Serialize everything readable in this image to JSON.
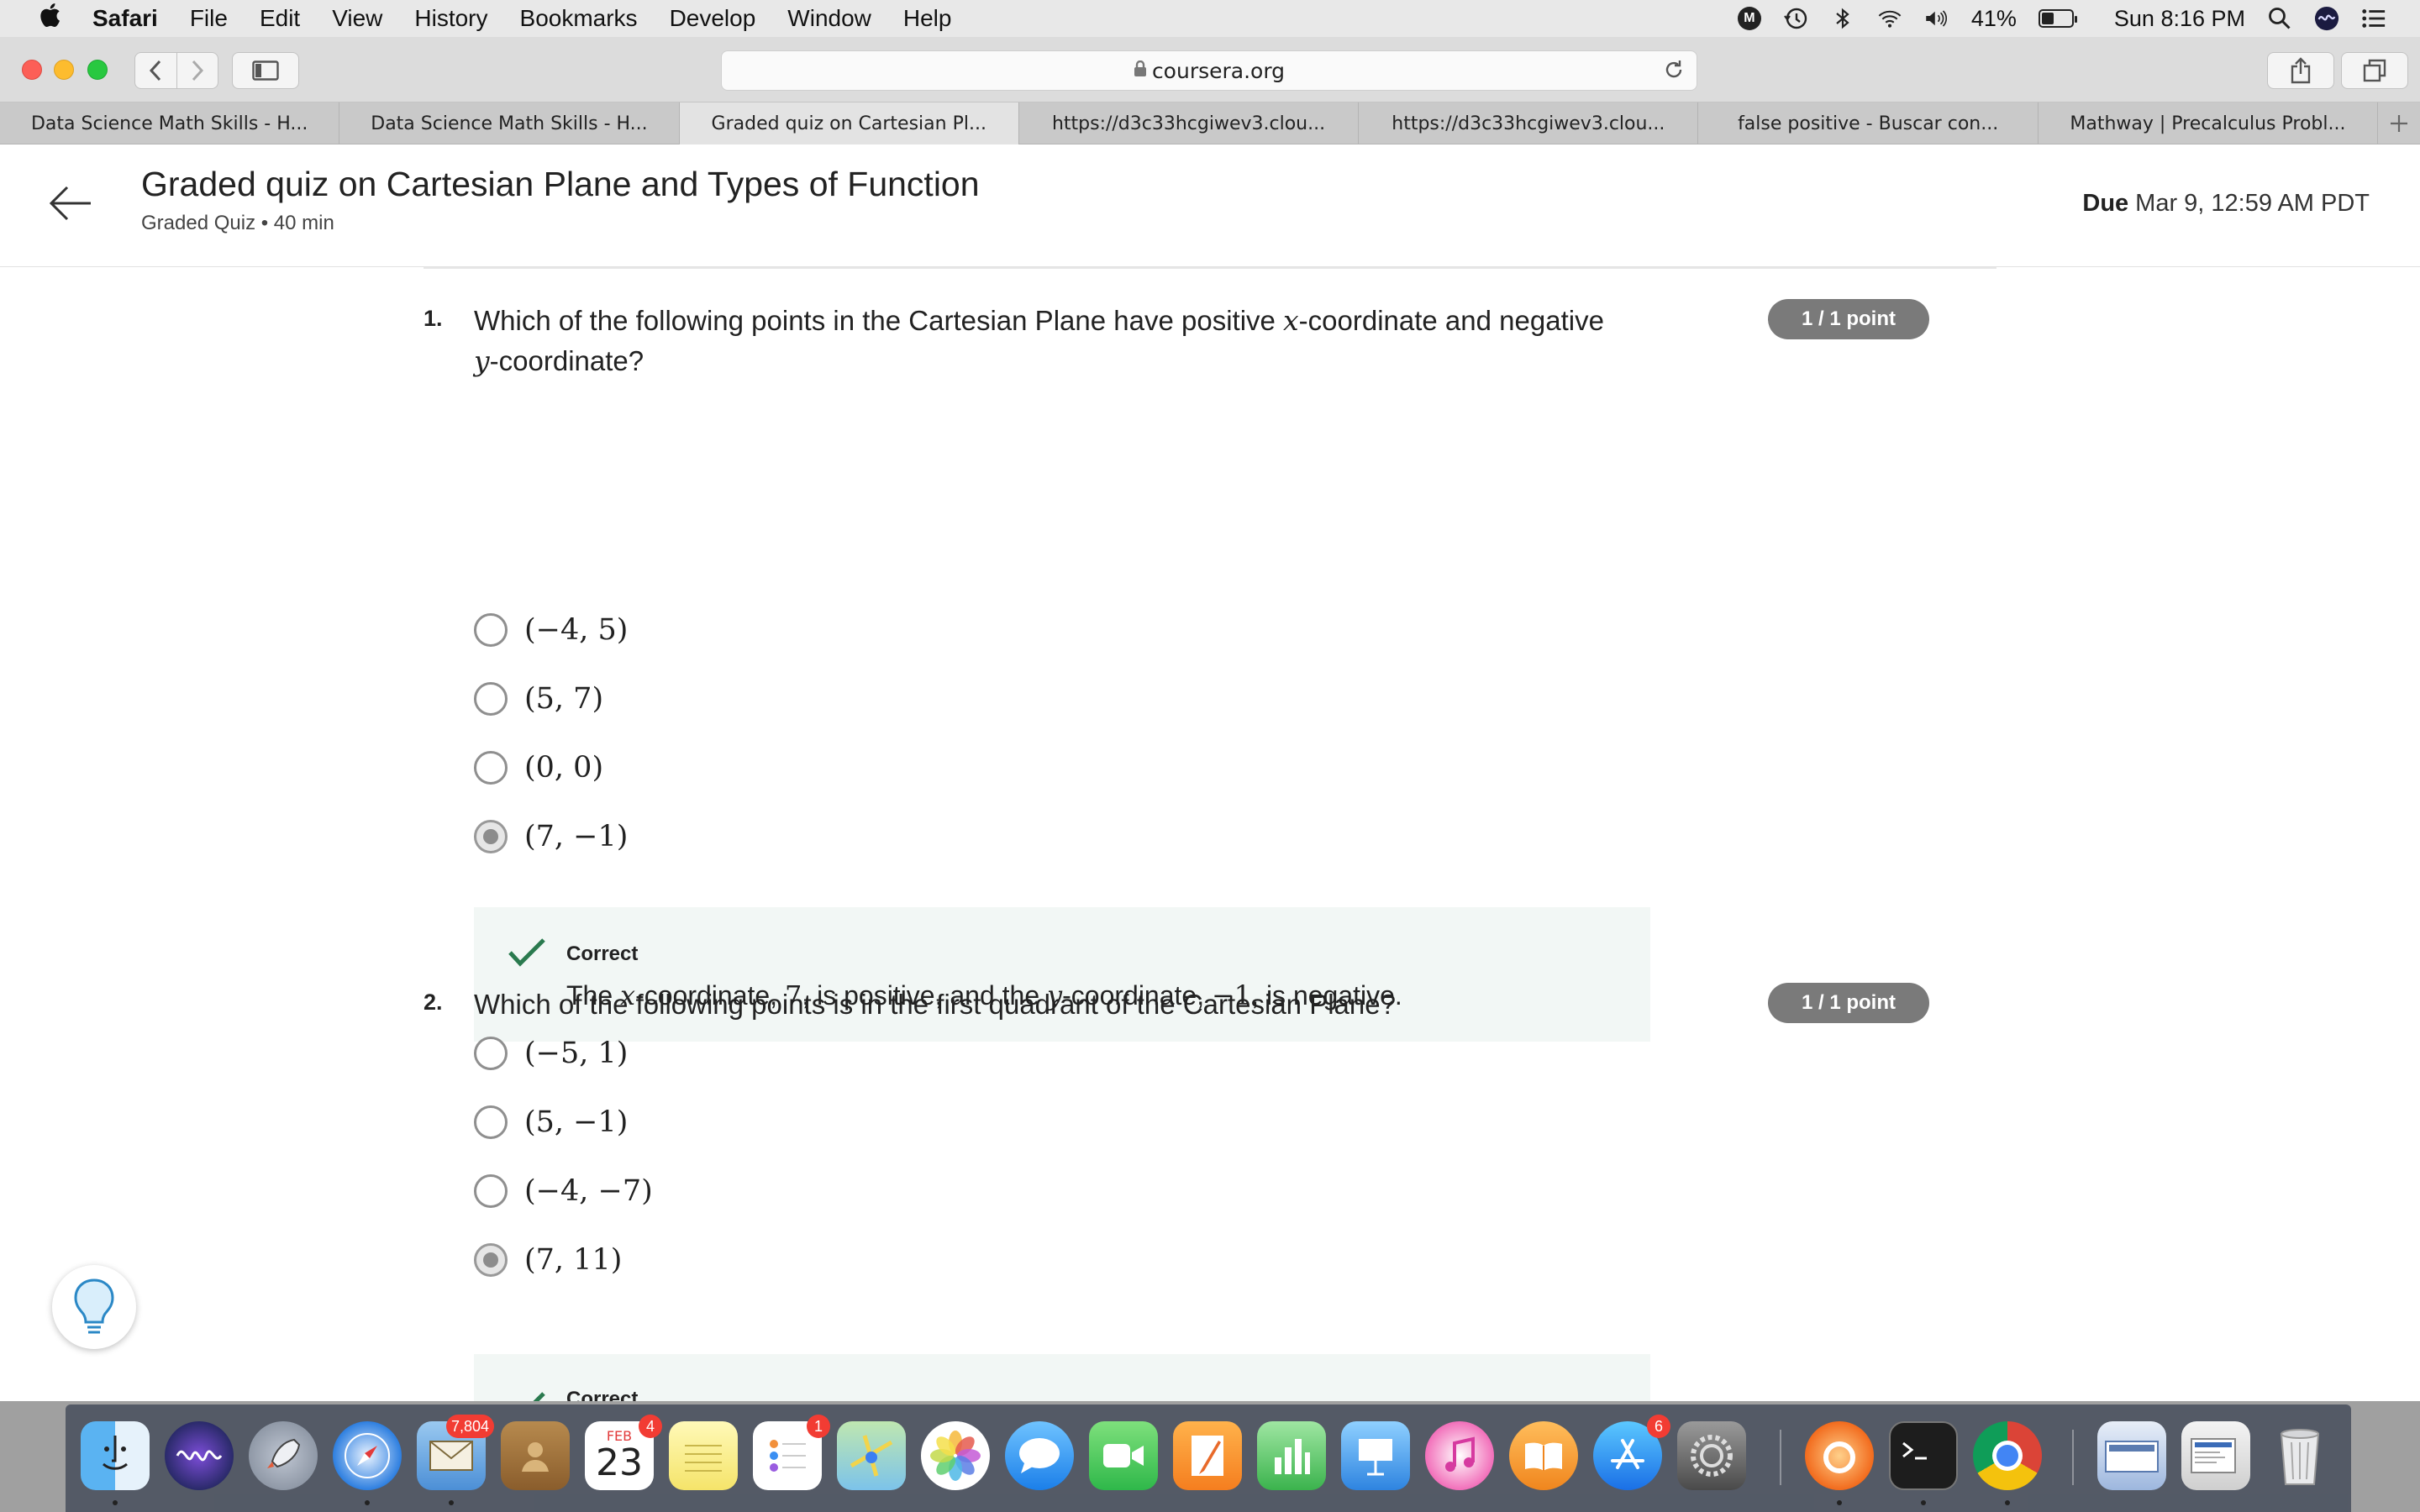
{
  "menubar": {
    "app": "Safari",
    "items": [
      "File",
      "Edit",
      "View",
      "History",
      "Bookmarks",
      "Develop",
      "Window",
      "Help"
    ],
    "battery_percent": "41%",
    "battery_level": 0.41,
    "clock": "Sun 8:16 PM",
    "status_icons": [
      "malwarebytes-icon",
      "time-machine-icon",
      "bluetooth-icon",
      "wifi-icon",
      "volume-icon",
      "battery-icon",
      "spotlight-icon",
      "siri-icon",
      "notification-center-icon"
    ]
  },
  "toolbar": {
    "address": "coursera.org"
  },
  "tabs": [
    {
      "label": "Data Science Math Skills - H..."
    },
    {
      "label": "Data Science Math Skills - H..."
    },
    {
      "label": "Graded quiz on Cartesian Pl..."
    },
    {
      "label": "https://d3c33hcgiwev3.clou..."
    },
    {
      "label": "https://d3c33hcgiwev3.clou..."
    },
    {
      "label": "false positive - Buscar con..."
    },
    {
      "label": "Mathway | Precalculus Probl..."
    }
  ],
  "header": {
    "title": "Graded quiz on Cartesian Plane and Types of Function",
    "subtitle": "Graded Quiz • 40 min",
    "due_label": "Due",
    "due_value": "Mar 9, 12:59 AM PDT"
  },
  "questions": [
    {
      "number": "1.",
      "text_a": "Which of the following points in the Cartesian Plane have positive ",
      "var_x": "x",
      "text_b": "-coordinate and negative ",
      "var_y": "y",
      "text_c": "-coordinate?",
      "points": "1 / 1 point",
      "options": [
        "(−4, 5)",
        "(5, 7)",
        "(0, 0)",
        "(7, −1)"
      ],
      "selected_index": 3,
      "feedback_title": "Correct",
      "feedback": {
        "a": "The ",
        "x": "x",
        "b": "-coordinate, ",
        "v1": "7",
        "c": ", is positive, and the ",
        "y": "y",
        "d": "-coordinate, ",
        "v2": "−1",
        "e": ", is negative."
      }
    },
    {
      "number": "2.",
      "text": "Which of the following points is in the first quadrant of the Cartesian Plane?",
      "points": "1 / 1 point",
      "options": [
        "(−5, 1)",
        "(5, −1)",
        "(−4, −7)",
        "(7, 11)"
      ],
      "selected_index": 3,
      "feedback_title": "Correct"
    }
  ],
  "dock": {
    "badges": {
      "mail": "7,804",
      "calendar": "4",
      "reminders": "1",
      "app_store": "6"
    },
    "calendar_month": "FEB",
    "calendar_day": "23"
  }
}
